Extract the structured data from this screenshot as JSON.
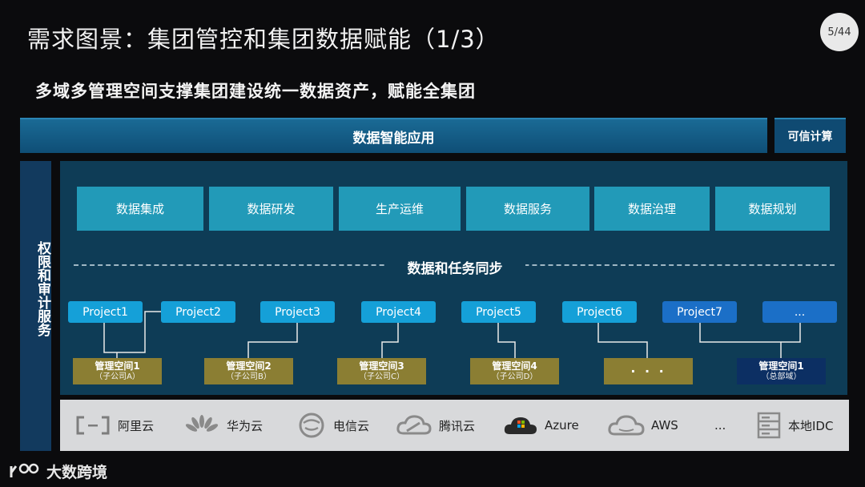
{
  "title": "需求图景：集团管控和集团数据赋能（1/3）",
  "page_number": "5/44",
  "subtitle": "多域多管理空间支撑集团建设统一数据资产，赋能全集团",
  "top_bar": {
    "app_label": "数据智能应用",
    "trusted_label": "可信计算"
  },
  "left_column": {
    "label": "权限和审计服务"
  },
  "modules": [
    "数据集成",
    "数据研发",
    "生产运维",
    "数据服务",
    "数据治理",
    "数据规划"
  ],
  "sync_label": "数据和任务同步",
  "projects": [
    "Project1",
    "Project2",
    "Project3",
    "Project4",
    "Project5",
    "Project6",
    "Project7",
    "..."
  ],
  "spaces": [
    {
      "name": "管理空间1",
      "sub": "（子公司A）"
    },
    {
      "name": "管理空间2",
      "sub": "（子公司B）"
    },
    {
      "name": "管理空间3",
      "sub": "（子公司C）"
    },
    {
      "name": "管理空间4",
      "sub": "（子公司D）"
    },
    {
      "name": "· · ·",
      "sub": ""
    },
    {
      "name": "管理空间1",
      "sub": "（总部域）"
    }
  ],
  "clouds": [
    {
      "label": "阿里云",
      "icon": "aliyun-icon"
    },
    {
      "label": "华为云",
      "icon": "huawei-icon"
    },
    {
      "label": "电信云",
      "icon": "telecom-icon"
    },
    {
      "label": "腾讯云",
      "icon": "tencent-cloud-icon"
    },
    {
      "label": "Azure",
      "icon": "azure-icon"
    },
    {
      "label": "AWS",
      "icon": "aws-icon"
    },
    {
      "label": "...",
      "icon": ""
    },
    {
      "label": "本地IDC",
      "icon": "server-rack-icon"
    }
  ],
  "brand": {
    "name": "大数跨境"
  },
  "colors": {
    "top_bar": "#125a85",
    "module": "#229ab8",
    "project": "#15a0d8",
    "space_subsidiary": "#8b7e33",
    "space_hq": "#0c2f63",
    "panel": "#0e3c56"
  }
}
